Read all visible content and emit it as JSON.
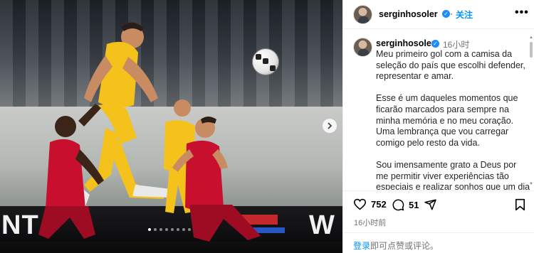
{
  "post": {
    "carousel": {
      "board_left": "NT",
      "board_right": "W",
      "next_icon": "chevron-right-icon",
      "dots_count": 8,
      "active_dot": 1
    }
  },
  "header": {
    "username": "serginhosoler",
    "follow_label": "关注",
    "more_label": "•••"
  },
  "caption": {
    "username": "serginhosoler",
    "time_ago": "16小时",
    "paragraphs": [
      "Meu primeiro gol com a camisa da seleção do país que escolhi defender, representar e amar.",
      "Esse é um daqueles momentos que ficarão marcados para sempre na minha memória e no meu coração. Uma lembrança que vou carregar comigo pelo resto da vida.",
      "Sou imensamente grato a Deus por me permitir viver experiências tão especiais e realizar sonhos que um dia pareciam tão distantes."
    ]
  },
  "actions": {
    "likes": "752",
    "comments": "51",
    "posted_ago": "16小时前"
  },
  "comment_box": {
    "login_label": "登录",
    "rest_label": "即可点赞或评论。"
  },
  "colors": {
    "accent": "#0095f6",
    "verified": "#1a8cff",
    "muted": "#737373",
    "team_yellow": "#f4c21b",
    "team_red": "#c8102e"
  }
}
